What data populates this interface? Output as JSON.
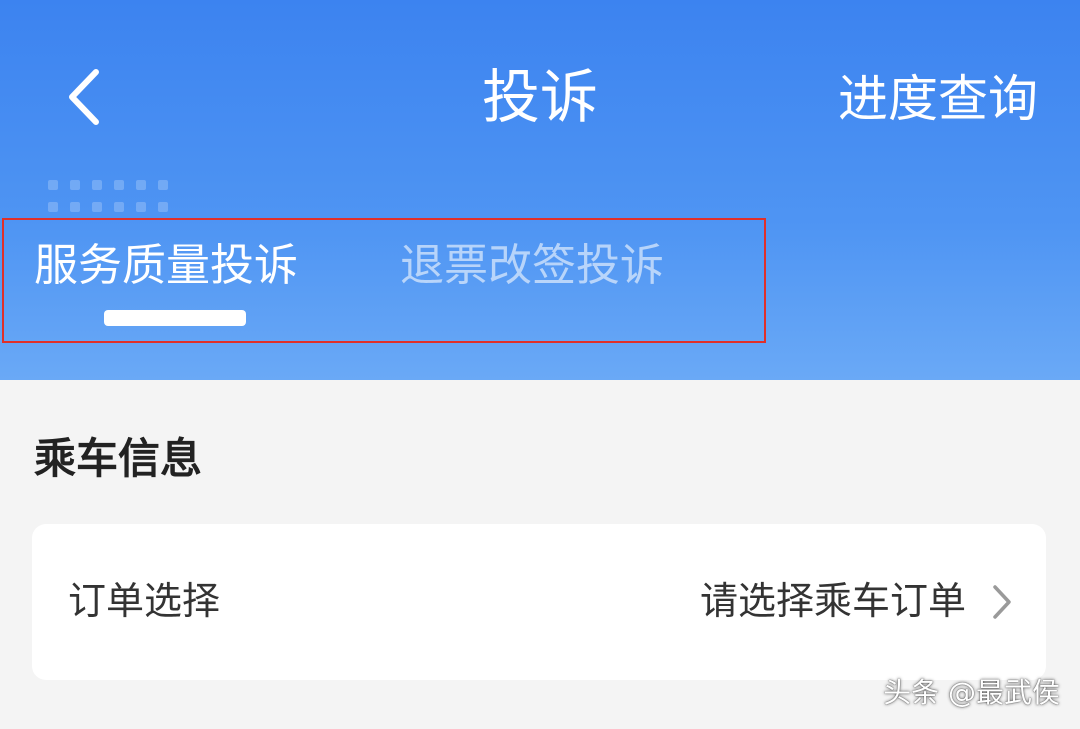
{
  "header": {
    "title": "投诉",
    "back_icon": "chevron-left-icon",
    "progress_label": "进度查询"
  },
  "tabs": [
    {
      "label": "服务质量投诉",
      "active": true
    },
    {
      "label": "退票改签投诉",
      "active": false
    }
  ],
  "section": {
    "title": "乘车信息"
  },
  "order_row": {
    "label": "订单选择",
    "value": "请选择乘车订单",
    "icon": "chevron-right-icon"
  },
  "watermark": "头条 @最武侯",
  "colors": {
    "header_top": "#3c83f0",
    "header_bottom": "#6aa9f6",
    "page_background": "#f4f4f4",
    "highlight_border": "#e0302a"
  }
}
